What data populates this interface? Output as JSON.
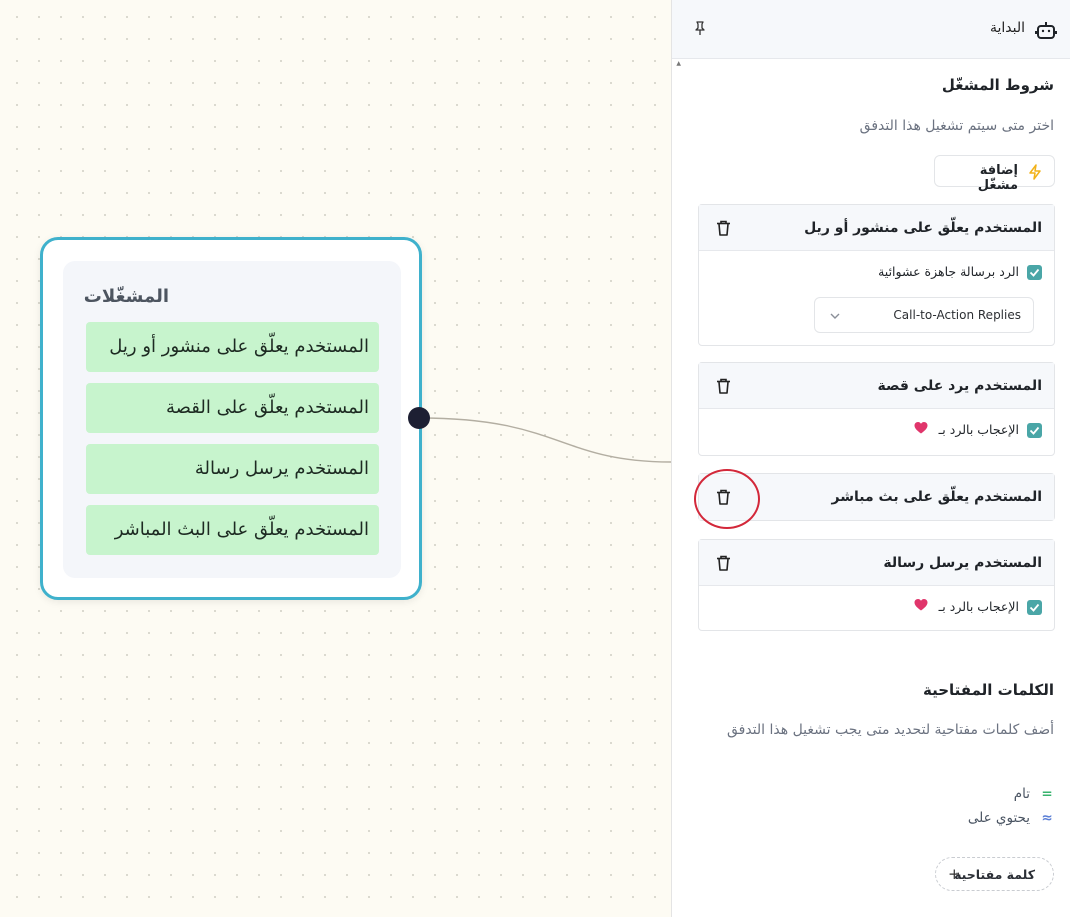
{
  "colors": {
    "node_border": "#3fb1cc",
    "node_item_bg": "#c7f4cd",
    "checkbox": "#4aa6a7",
    "highlight": "#d3283a",
    "bolt": "#f2b219",
    "heart": "#e0356b"
  },
  "canvas": {
    "node": {
      "title": "المشغّلات",
      "items": [
        "المستخدم يعلّق على منشور أو ريل",
        "المستخدم يعلّق على القصة",
        "المستخدم يرسل رسالة",
        "المستخدم يعلّق على البث المباشر"
      ]
    }
  },
  "panel": {
    "header": {
      "title": "البداية",
      "bot_icon": "bot-icon",
      "pin_icon": "pin-icon"
    },
    "triggers_section": {
      "title": "شروط المشغّل",
      "description": "اختر متى سيتم تشغيل هذا التدفق",
      "add_button_label": "إضافة مشغّل",
      "add_button_icon": "lightning-icon"
    },
    "cards": [
      {
        "title": "المستخدم يعلّق على منشور أو ريل",
        "option_label": "الرد برسالة جاهزة عشوائية",
        "select_value": "Call-to-Action Replies"
      },
      {
        "title": "المستخدم يرد على قصة",
        "option_label": "الإعجاب بالرد بـ",
        "option_icon": "heart-icon"
      },
      {
        "title": "المستخدم يعلّق على بث مباشر"
      },
      {
        "title": "المستخدم يرسل رسالة",
        "option_label": "الإعجاب بالرد بـ",
        "option_icon": "heart-icon"
      }
    ],
    "keywords_section": {
      "title": "الكلمات المفتاحية",
      "description": "أضف كلمات مفتاحية لتحديد متى يجب تشغيل هذا التدفق",
      "legend": [
        {
          "symbol": "=",
          "label": "تام"
        },
        {
          "symbol": "≈",
          "label": "يحتوي على"
        }
      ],
      "add_button_label": "كلمة مفتاحية",
      "add_button_symbol": "+"
    }
  }
}
